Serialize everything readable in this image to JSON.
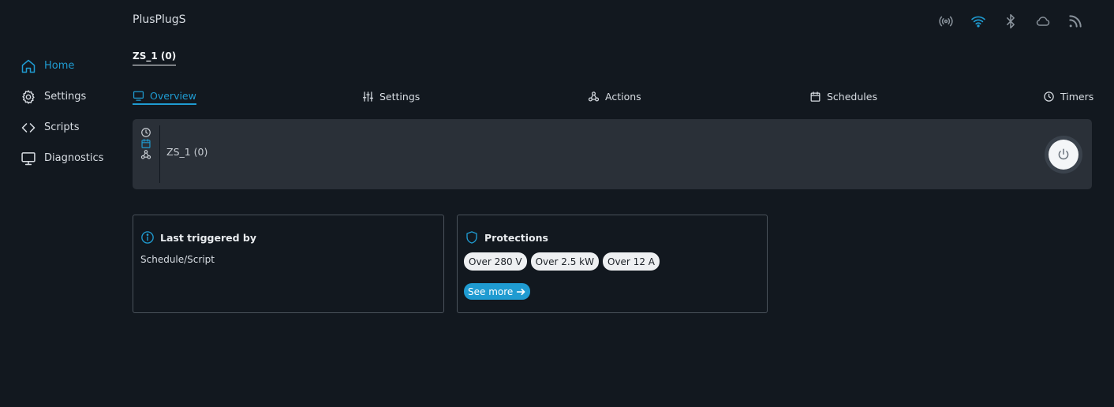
{
  "app": {
    "title": "PlusPlugS"
  },
  "sidebar": {
    "items": [
      {
        "label": "Home",
        "icon": "home-icon",
        "active": true
      },
      {
        "label": "Settings",
        "icon": "gear-icon",
        "active": false
      },
      {
        "label": "Scripts",
        "icon": "code-icon",
        "active": false
      },
      {
        "label": "Diagnostics",
        "icon": "monitor-icon",
        "active": false
      }
    ]
  },
  "status_icons": [
    "radio-waves-icon",
    "wifi-icon",
    "bluetooth-icon",
    "cloud-icon",
    "rss-icon"
  ],
  "device": {
    "title": "ZS_1 (0)",
    "name": "ZS_1 (0)"
  },
  "tabs": [
    {
      "label": "Overview",
      "icon": "monitor-icon",
      "active": true
    },
    {
      "label": "Settings",
      "icon": "sliders-icon",
      "active": false
    },
    {
      "label": "Actions",
      "icon": "webhook-icon",
      "active": false
    },
    {
      "label": "Schedules",
      "icon": "calendar-icon",
      "active": false
    },
    {
      "label": "Timers",
      "icon": "clock-icon",
      "active": false
    }
  ],
  "device_card": {
    "mini_icons": [
      "clock-icon",
      "calendar-icon",
      "webhook-icon"
    ]
  },
  "last_triggered": {
    "title": "Last triggered by",
    "value": "Schedule/Script"
  },
  "protections": {
    "title": "Protections",
    "chips": [
      "Over 280 V",
      "Over 2.5 kW",
      "Over 12 A"
    ],
    "see_more": "See more"
  },
  "colors": {
    "accent": "#1f9bd1",
    "background": "#12181f",
    "card": "#2a3038"
  }
}
